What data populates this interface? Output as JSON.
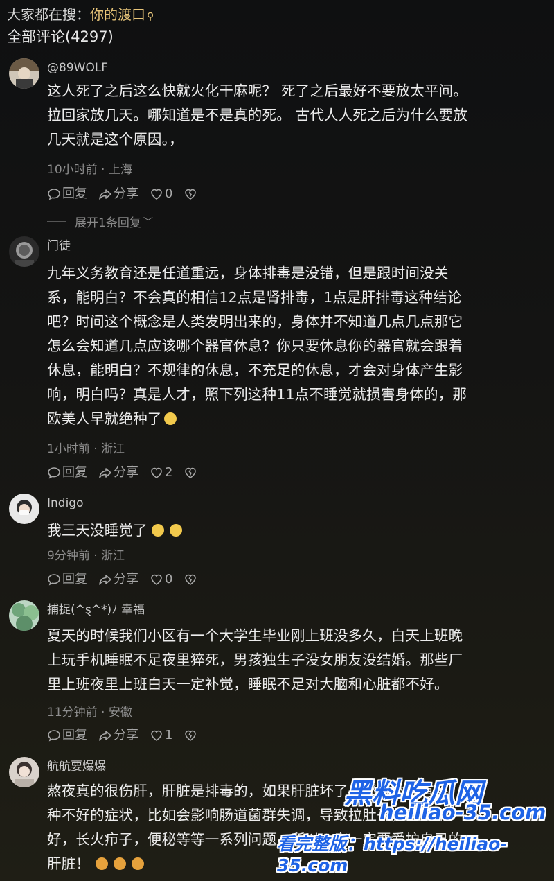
{
  "search": {
    "prefix": "大家都在搜：",
    "keyword": "你的渡口"
  },
  "comments_header": "全部评论(4297)",
  "comments": [
    {
      "user": "@89WOLF",
      "lines": [
        "这人死了之后这么快就火化干麻呢？ 死了之后最好不要放太平间。",
        "拉回家放几天。哪知道是不是真的死。 古代人人死之后为什么要放",
        "几天就是这个原因。，"
      ],
      "meta": "10小时前 · 上海",
      "reply": "回复",
      "share": "分享",
      "likes": "0",
      "expand": "展开1条回复"
    },
    {
      "user": "门徒",
      "lines": [
        "九年义务教育还是任道重远，身体排毒是没错，但是跟时间没关",
        "系，能明白？不会真的相信12点是肾排毒，1点是肝排毒这种结论",
        "吧？时间这个概念是人类发明出来的，身体并不知道几点几点那它",
        "怎么会知道几点应该哪个器官休息？你只要休息你的器官就会跟着",
        "休息，能明白？不规律的休息，不充足的休息，才会对身体产生影",
        "响，明白吗？真是人才，照下列这种11点不睡觉就损害身体的，那",
        "欧美人早就绝种了"
      ],
      "meta": "1小时前 · 浙江",
      "reply": "回复",
      "share": "分享",
      "likes": "2"
    },
    {
      "user": "Indigo",
      "lines": [
        "我三天没睡觉了"
      ],
      "meta": "9分钟前 · 浙江",
      "reply": "回复",
      "share": "分享",
      "likes": "0"
    },
    {
      "user": "捕捉(^ȿ^*)ﾉ 幸福",
      "lines": [
        "夏天的时候我们小区有一个大学生毕业刚上班没多久，白天上班晚",
        "上玩手机睡眠不足夜里猝死，男孩独生子没女朋友没结婚。那些厂",
        "里上班夜里上班白天一定补觉，睡眠不足对大脑和心脏都不好。"
      ],
      "meta": "11分钟前 · 安徽",
      "reply": "回复",
      "share": "分享",
      "likes": "1"
    },
    {
      "user": "航航要爆爆",
      "lines": [
        "熬夜真的很伤肝，肝脏是排毒的，如果肝脏坏了，那身体会有各",
        "种不好的症状，比如会影响肠道菌群失调，导致拉肚子，睡眠不",
        "好，长火疖子，便秘等等一系列问题，所以一定一定要爱护自己的",
        "肝脏！"
      ]
    }
  ],
  "watermark": {
    "site": "黑料吃瓜网",
    "domain": "heiliao-35.com",
    "line2": "看完整版：https://heiliao-35.com"
  },
  "colors": {
    "keyword": "#e9c67a",
    "watermark": "#1e63e6"
  }
}
